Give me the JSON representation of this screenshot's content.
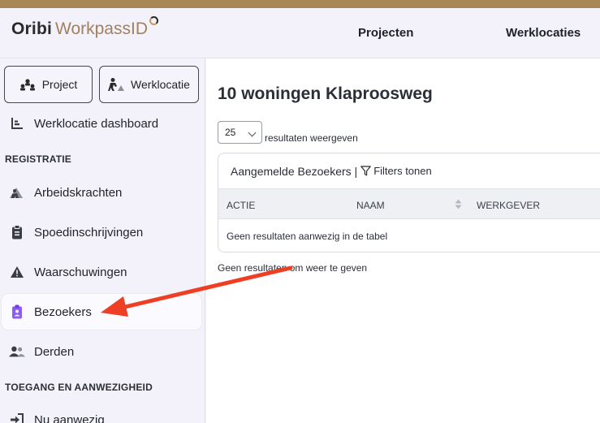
{
  "header": {
    "brand": "Oribi",
    "product": "WorkpassID",
    "nav": [
      "Projecten",
      "Werklocaties"
    ]
  },
  "sidebar": {
    "switch_project": "Project",
    "switch_werklocatie": "Werklocatie",
    "dashboard": "Werklocatie dashboard",
    "section_registratie": "REGISTRATIE",
    "items": [
      "Arbeidskrachten",
      "Spoedinschrijvingen",
      "Waarschuwingen",
      "Bezoekers",
      "Derden"
    ],
    "section_toegang": "TOEGANG EN AANWEZIGHEID",
    "nu_aanwezig": "Nu aanwezig",
    "active_item": "Bezoekers"
  },
  "main": {
    "title": "10 woningen Klaproosweg",
    "page_length": "25",
    "page_length_label": "resultaten weergeven",
    "table_title": "Aangemelde Bezoekers |",
    "filter_label": "Filters tonen",
    "columns": [
      "ACTIE",
      "NAAM",
      "WERKGEVER"
    ],
    "empty_message": "Geen resultaten aanwezig in de tabel",
    "footer": "Geen resultaten om weer te geven"
  },
  "colors": {
    "topbar": "#a88656",
    "accent_purple": "#8b5cf6",
    "arrow": "#ee3f24"
  }
}
